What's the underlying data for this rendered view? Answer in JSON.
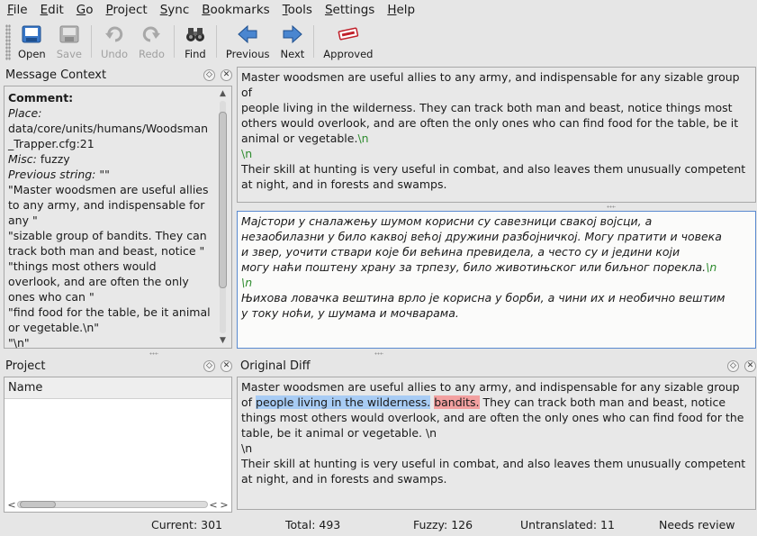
{
  "menu": [
    "File",
    "Edit",
    "Go",
    "Project",
    "Sync",
    "Bookmarks",
    "Tools",
    "Settings",
    "Help"
  ],
  "menu_mnemonic": [
    "F",
    "E",
    "G",
    "P",
    "S",
    "B",
    "T",
    "S",
    "H"
  ],
  "toolbar": {
    "open": "Open",
    "save": "Save",
    "undo": "Undo",
    "redo": "Redo",
    "find": "Find",
    "previous": "Previous",
    "next": "Next",
    "approved": "Approved"
  },
  "context": {
    "title": "Message Context",
    "comment_label": "Comment:",
    "place_label": "Place:",
    "place_value_1": "data/core/units/humans/Woodsman",
    "place_value_2": "_Trapper.cfg:21",
    "misc_label": "Misc:",
    "misc_value": " fuzzy",
    "prev_label": "Previous string:",
    "prev_value": " \"\"",
    "lines": [
      "\"Master woodsmen are useful allies",
      "to any army, and indispensable for",
      "any \"",
      "\"sizable group of bandits. They can",
      "track both man and beast, notice \"",
      "\"things most others would",
      "overlook, and are often the only",
      "ones who can \"",
      "\"find food for the table, be it animal",
      "or vegetable.\\n\"",
      "\"\\n\""
    ]
  },
  "source": {
    "line1": "Master woodsmen are useful allies to any army, and indispensable for any sizable group of",
    "line2": "people living in the wilderness. They can track both man and beast, notice things most",
    "line3": "others would overlook, and are often the only ones who can find food for the table, be it",
    "line4": "animal or vegetable.",
    "tag1": "\\n",
    "tag2": "\\n",
    "line5": "Their skill at hunting is very useful in combat, and also leaves them unusually competent",
    "line6": "at night, and in forests and swamps."
  },
  "translation": {
    "line1": "Мајстори у сналажењу шумом корисни су савезници свакој војсци, а",
    "line2": "незаобилазни у било каквој већој дружини разбојничкој. Могу пратити и човека",
    "line3": "и звер, уочити ствари које би већина превидела, а често су и једини који",
    "line4": "могу наћи поштену храну за трпезу, било животињског или биљног порекла.",
    "tag1": "\\n",
    "tag2": "\\n",
    "line5": "Њихова ловачка вештина врло је корисна у борби, а чини их и необично вештим",
    "line6": "у току ноћи, у шумама и мочварама."
  },
  "project": {
    "title": "Project",
    "column": "Name"
  },
  "diff": {
    "title": "Original Diff",
    "line1": "Master woodsmen are useful allies to any army, and indispensable for any sizable group",
    "line2_pre": "of ",
    "line2_added": "people living in the wilderness.",
    "line2_space": " ",
    "line2_removed": "bandits.",
    "line2_post": " They can track both man and beast, notice",
    "line3": "things most others would overlook, and are often the only ones who can find food for the",
    "line4": "table, be it animal or vegetable. \\n",
    "line5": "\\n",
    "line6": "Their skill at hunting is very useful in combat, and also leaves them unusually competent",
    "line7": "at night, and in forests and swamps.",
    "colors": {
      "added": "#a8ccf4",
      "removed": "#f2a0a0"
    }
  },
  "status": {
    "current": "Current: 301",
    "total": "Total: 493",
    "fuzzy": "Fuzzy: 126",
    "untranslated": "Untranslated: 11",
    "state": "Needs review"
  },
  "colors": {
    "tag": "#2e8b2e",
    "focus_border": "#5a8ad0"
  }
}
